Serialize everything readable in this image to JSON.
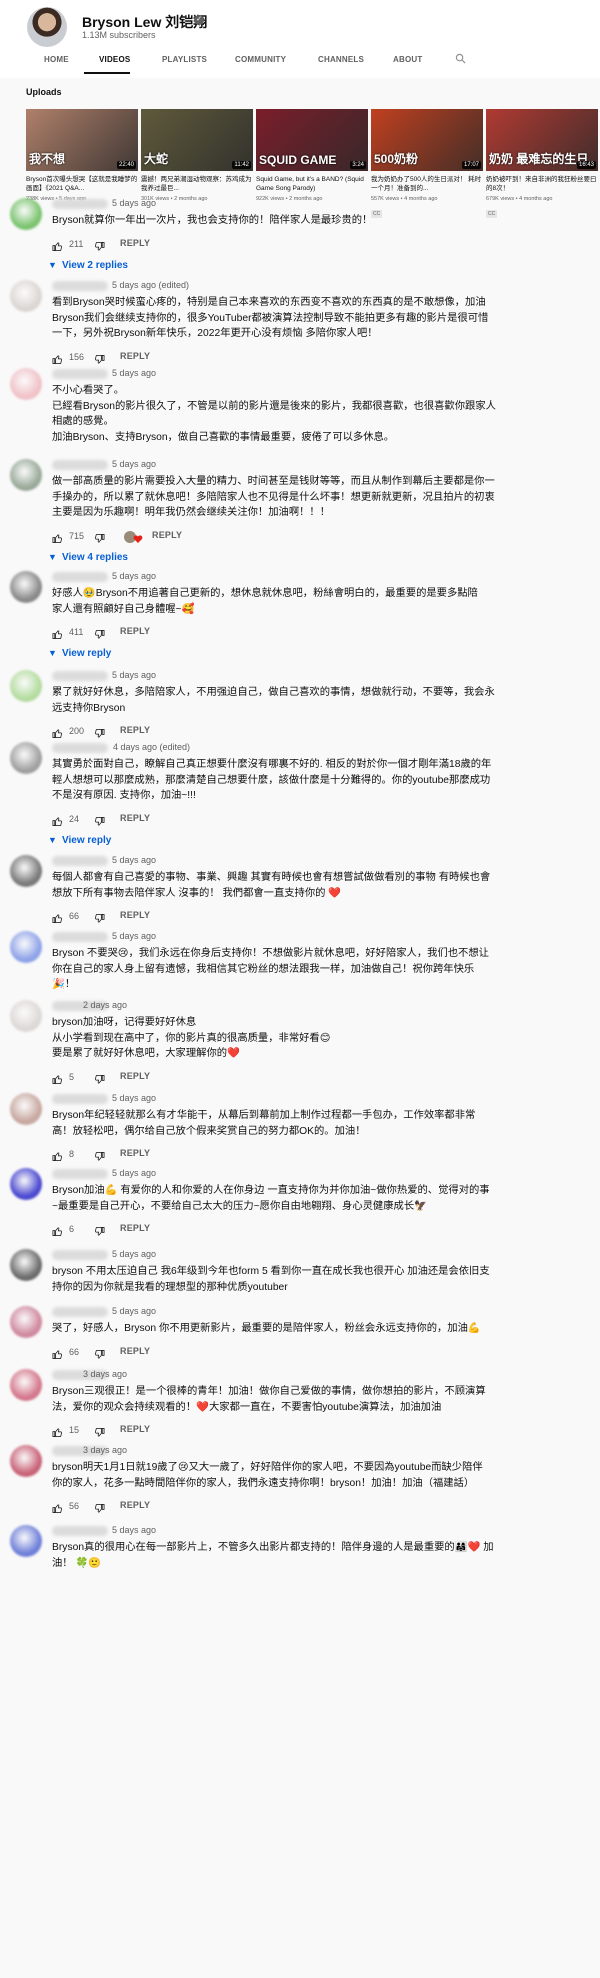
{
  "channel": {
    "name": "Bryson Lew 刘铠翔",
    "subscribers": "1.13M subscribers",
    "tabs": [
      {
        "label": "HOME"
      },
      {
        "label": "VIDEOS"
      },
      {
        "label": "PLAYLISTS"
      },
      {
        "label": "COMMUNITY"
      },
      {
        "label": "CHANNELS"
      },
      {
        "label": "ABOUT"
      }
    ],
    "active_tab": "VIDEOS",
    "search_icon": "search-icon"
  },
  "uploads": {
    "title": "Uploads",
    "videos": [
      {
        "thumb_text": "我不想",
        "duration": "22:40",
        "title": "Bryson首次曝头想哭【这就是我睡梦的画面】《2021 Q&A...",
        "meta": "238K views • 5 days ago",
        "cc": "",
        "bg": "#b0806a"
      },
      {
        "thumb_text": "大蛇",
        "duration": "11:42",
        "title": "震撼！两兄弟潮湿动物观察：苏鸡成为我养过最巨...",
        "meta": "301K views • 2 months ago",
        "cc": "",
        "bg": "#5f5a3b"
      },
      {
        "thumb_text": "SQUID GAME",
        "duration": "3:24",
        "title": "Squid Game, but it's a BAND? (Squid Game Song Parody)",
        "meta": "922K views • 2 months ago",
        "cc": "",
        "bg": "#7b1e2a"
      },
      {
        "thumb_text": "500奶粉",
        "duration": "17:07",
        "title": "我为奶奶办了500人的生日派对！ 耗时一个月！准备到的...",
        "meta": "557K views • 4 months ago",
        "cc": "CC",
        "bg": "#c0401f"
      },
      {
        "thumb_text": "奶奶 最难忘的生日",
        "duration": "16:43",
        "title": "奶奶被吓到！来自非洲的我狂粉丝要曰的8次！",
        "meta": "679K views • 4 months ago",
        "cc": "CC",
        "bg": "#b03a32"
      }
    ]
  },
  "comments": [
    {
      "time": "5 days ago",
      "text": [
        "Bryson就算你一年出一次片，我也会支持你的！陪伴家人是最珍贵的！"
      ],
      "likes": "211",
      "reply_label": "REPLY",
      "heart": false,
      "replies": "View 2 replies",
      "avatar": "#7cc470"
    },
    {
      "time": "5 days ago (edited)",
      "text": [
        "看到Bryson哭时候蛮心疼的，特别是自己本来喜欢的东西变不喜欢的东西真的是不敢想像，加油",
        "Bryson我们会继续支持你的，很多YouTuber都被演算法控制导致不能拍更多有趣的影片是很可惜",
        "一下，另外祝Bryson新年快乐，2022年更开心没有烦恼 多陪你家人吧！"
      ],
      "likes": "156",
      "reply_label": "REPLY",
      "heart": false,
      "replies": "",
      "avatar": "#dcd6d2"
    },
    {
      "time": "5 days ago",
      "text": [
        "不小心看哭了。",
        "已經看Bryson的影片很久了，不管是以前的影片還是後來的影片，我都很喜歡，也很喜歡你跟家人",
        "相處的感覺。",
        "加油Bryson、支持Bryson，做自己喜歡的事情最重要，疲倦了可以多休息。"
      ],
      "likes": "",
      "reply_label": "",
      "heart": false,
      "replies": "",
      "avatar": "#f0c2c8"
    },
    {
      "time": "5 days ago",
      "text": [
        "做一部高质量的影片需要投入大量的精力、时间甚至是钱财等等，而且从制作到幕后主要都是你一",
        "手操办的，所以累了就休息吧！多陪陪家人也不见得是什么坏事！想更新就更新，况且拍片的初衷",
        "主要是因为乐趣啊！明年我仍然会继续关注你！加油啊！！！"
      ],
      "likes": "715",
      "reply_label": "REPLY",
      "heart": true,
      "replies": "View 4 replies",
      "avatar": "#9aaa9a"
    },
    {
      "time": "5 days ago",
      "text": [
        "好感人🥹Bryson不用追著自己更新的，想休息就休息吧，粉絲會明白的，最重要的是要多點陪",
        "家人還有照顧好自己身體喔~🥰"
      ],
      "likes": "411",
      "reply_label": "REPLY",
      "heart": false,
      "replies": "View reply",
      "avatar": "#8a8a8a"
    },
    {
      "time": "5 days ago",
      "text": [
        "累了就好好休息，多陪陪家人，不用强迫自己，做自己喜欢的事情，想做就行动，不要等，我会永",
        "远支持你Bryson"
      ],
      "likes": "200",
      "reply_label": "REPLY",
      "heart": false,
      "replies": "",
      "avatar": "#b4dca0"
    },
    {
      "time": "4 days ago (edited)",
      "text": [
        "其實勇於面對自己，瞭解自己真正想要什麼沒有哪裏不好的. 相反的對於你一個才剛年滿18歲的年",
        "輕人想想可以那麼成熟，那麼清楚自己想要什麼，該做什麼是十分難得的。你的youtube那麼成功",
        "不是沒有原因. 支持你，加油~!!!"
      ],
      "likes": "24",
      "reply_label": "REPLY",
      "heart": false,
      "replies": "View reply",
      "avatar": "#a0a0a0"
    },
    {
      "time": "5 days ago",
      "text": [
        "每個人都會有自己喜愛的事物、事業、興趣 其實有時候也會有想嘗試做做看別的事物 有時候也會",
        "想放下所有事物去陪伴家人 沒事的！ 我們都會一直支持你的 ❤️"
      ],
      "likes": "66",
      "reply_label": "REPLY",
      "heart": false,
      "replies": "",
      "avatar": "#7a7a7a"
    },
    {
      "time": "5 days ago",
      "text": [
        "Bryson 不要哭😢，我们永远在你身后支持你！不想做影片就休息吧，好好陪家人，我们也不想让",
        "你在自己的家人身上留有遗憾，我相信其它粉丝的想法跟我一样，加油做自己！祝你跨年快乐",
        "🎉！"
      ],
      "likes": "",
      "reply_label": "",
      "heart": false,
      "replies": "",
      "avatar": "#8fa3e8"
    },
    {
      "time": "2 days ago",
      "text": [
        "bryson加油呀，记得要好好休息",
        "从小学看到现在高中了，你的影片真的很高质量，非常好看😊",
        "要是累了就好好休息吧，大家理解你的❤️"
      ],
      "likes": "5",
      "reply_label": "REPLY",
      "heart": false,
      "replies": "",
      "avatar": "#dcd8d6"
    },
    {
      "time": "5 days ago",
      "text": [
        "Bryson年纪轻轻就那么有才华能干，从幕后到幕前加上制作过程都一手包办，工作效率都非常",
        "高！放轻松吧，偶尔给自己放个假来奖赏自己的努力都OK的。加油！"
      ],
      "likes": "8",
      "reply_label": "REPLY",
      "heart": false,
      "replies": "",
      "avatar": "#c8a8a0"
    },
    {
      "time": "5 days ago",
      "text": [
        "Bryson加油💪 有爱你的人和你爱的人在你身边 一直支持你为并你加油~做你热爱的、觉得对的事",
        "~最重要是自己开心，不要给自己太大的压力~愿你自由地翱翔、身心灵健康成长🦅"
      ],
      "likes": "6",
      "reply_label": "REPLY",
      "heart": false,
      "replies": "",
      "avatar": "#4c4ad0"
    },
    {
      "time": "5 days ago",
      "text": [
        "bryson 不用太压迫自己 我6年级到今年也form 5 看到你一直在成长我也很开心 加油还是会依旧支",
        "持你的因为你就是我看的理想型的那种优质youtuber"
      ],
      "likes": "",
      "reply_label": "",
      "heart": false,
      "replies": "",
      "avatar": "#6c6c6c"
    },
    {
      "time": "5 days ago",
      "text": [
        "哭了，好感人，Bryson 你不用更新影片，最重要的是陪伴家人，粉丝会永远支持你的，加油💪"
      ],
      "likes": "66",
      "reply_label": "REPLY",
      "heart": false,
      "replies": "",
      "avatar": "#d08aa0"
    },
    {
      "time": "3 days ago",
      "text": [
        "Bryson三观很正！是一个很棒的青年！加油！做你自己爱做的事情，做你想拍的影片，不顾演算",
        "法，爱你的观众会持续观看的！❤️大家都一直在，不要害怕youtube演算法，加油加油"
      ],
      "likes": "15",
      "reply_label": "REPLY",
      "heart": false,
      "replies": "",
      "avatar": "#d4788c"
    },
    {
      "time": "3 days ago",
      "text": [
        "bryson明天1月1日就19歲了😢又大一歲了，好好陪伴你的家人吧，不要因為youtube而缺少陪伴",
        "你的家人，花多一點時間陪伴你的家人，我們永遠支持你啊！bryson！加油！加油（福建話）"
      ],
      "likes": "56",
      "reply_label": "REPLY",
      "heart": false,
      "replies": "",
      "avatar": "#c86478"
    },
    {
      "time": "5 days ago",
      "text": [
        "Bryson真的很用心在每一部影片上，不管多久出影片都支持的！陪伴身邊的人是最重要的👨‍👩‍👧❤️ 加",
        "油！ 🍀🙂"
      ],
      "likes": "",
      "reply_label": "",
      "heart": false,
      "replies": "",
      "avatar": "#7080d8"
    }
  ]
}
